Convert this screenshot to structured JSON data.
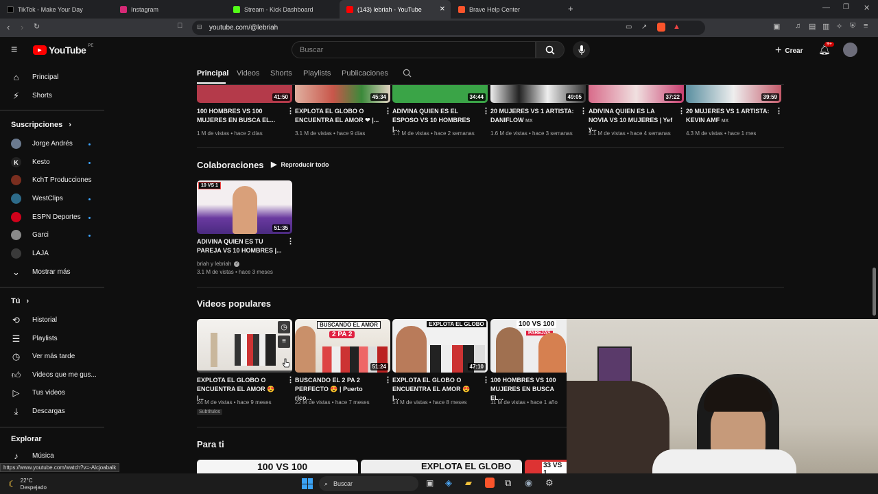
{
  "browser": {
    "tabs": [
      {
        "label": "TikTok - Make Your Day",
        "color": "#111"
      },
      {
        "label": "Instagram",
        "color": "#d62976"
      },
      {
        "label": "Stream - Kick Dashboard",
        "color": "#53fc18"
      },
      {
        "label": "(143) lebriah - YouTube",
        "color": "#ff0000"
      },
      {
        "label": "Brave Help Center",
        "color": "#fb542b"
      }
    ],
    "url": "youtube.com/@lebriah",
    "status_url": "https://www.youtube.com/watch?v=-Alcjoabalk"
  },
  "header": {
    "logo": "YouTube",
    "logo_region": "PE",
    "search_placeholder": "Buscar",
    "create_label": "Crear",
    "notif_badge": "9+"
  },
  "sidebar": {
    "main": [
      {
        "label": "Principal",
        "icon": "home-icon"
      },
      {
        "label": "Shorts",
        "icon": "shorts-icon"
      }
    ],
    "subs_title": "Suscripciones",
    "subs": [
      {
        "label": "Jorge Andrés",
        "color": "#6b7a8f",
        "dot": true
      },
      {
        "label": "Kesto",
        "color": "#222",
        "dot": true
      },
      {
        "label": "KchT Producciones",
        "color": "#7a2e1f",
        "dot": false
      },
      {
        "label": "WestClips",
        "color": "#2d6b8a",
        "dot": true
      },
      {
        "label": "ESPN Deportes",
        "color": "#d0021b",
        "dot": true
      },
      {
        "label": "Garci",
        "color": "#8a8a8a",
        "dot": true
      },
      {
        "label": "LAJA",
        "color": "#3a3a3a",
        "dot": false
      }
    ],
    "show_more": "Mostrar más",
    "you_title": "Tú",
    "you": [
      {
        "label": "Historial",
        "icon": "history-icon"
      },
      {
        "label": "Playlists",
        "icon": "playlists-icon"
      },
      {
        "label": "Ver más tarde",
        "icon": "watch-later-icon"
      },
      {
        "label": "Videos que me gus...",
        "icon": "like-icon"
      },
      {
        "label": "Tus videos",
        "icon": "your-videos-icon"
      },
      {
        "label": "Descargas",
        "icon": "downloads-icon"
      }
    ],
    "explore_title": "Explorar",
    "explore": [
      {
        "label": "Música",
        "icon": "music-icon"
      }
    ]
  },
  "channel_tabs": [
    "Principal",
    "Videos",
    "Shorts",
    "Playlists",
    "Publicaciones"
  ],
  "row1": [
    {
      "title": "100 HOMBRES VS 100 MUJERES EN BUSCA EL...",
      "meta": "1 M de vistas • hace 2 días",
      "dur": "41:50",
      "color": "#b43a4a"
    },
    {
      "title": "EXPLOTA EL GLOBO O ENCUENTRA EL AMOR ❤ |...",
      "meta": "3.1 M de vistas • hace 9 días",
      "dur": "45:34",
      "color": "#c8564a"
    },
    {
      "title": "ADIVINA QUIEN ES EL ESPOSO VS 10 HOMBRES |...",
      "meta": "1.7 M de vistas • hace 2 semanas",
      "dur": "34:44",
      "color": "#3aa447"
    },
    {
      "title": "20 MUJERES VS 1 ARTISTA: DANIFLOW",
      "tag": "MX",
      "meta": "1.6 M de vistas • hace 3 semanas",
      "dur": "49:05",
      "color": "#e8e0e0"
    },
    {
      "title": "ADIVINA QUIEN ES LA NOVIA VS 10 MUJERES | Yef y...",
      "meta": "3.1 M de vistas • hace 4 semanas",
      "dur": "37:22",
      "color": "#d86b8a"
    },
    {
      "title": "20 MUJERES VS 1 ARTISTA: KEVIN AMF",
      "tag": "MX",
      "meta": "4.3 M de vistas • hace 1 mes",
      "dur": "39:59",
      "color": "#5a8fa0"
    }
  ],
  "collab": {
    "title": "Colaboraciones",
    "play_all": "Reproducir todo",
    "video": {
      "title": "ADIVINA QUIEN ES TU PAREJA VS 10 HOMBRES |...",
      "channel": "briah y lebriah",
      "meta": "3.1 M de vistas • hace 3 meses",
      "dur": "51:35",
      "badge": "10 VS 1"
    }
  },
  "popular": {
    "title": "Videos populares",
    "videos": [
      {
        "title": "EXPLOTA EL GLOBO O ENCUENTRA EL AMOR 😍 |...",
        "meta": "24 M de vistas • hace 9 meses",
        "dur": "",
        "badge": "Subtítulos",
        "color": "#e9e6e2"
      },
      {
        "title": "BUSCANDO EL 2 PA 2 PERFECTO 😍 | Puerto rico...",
        "meta": "22 M de vistas • hace 7 meses",
        "dur": "51:24",
        "overlay": "BUSCANDO EL AMOR",
        "overlay2": "2 PA 2",
        "color": "#f2efe9"
      },
      {
        "title": "EXPLOTA EL GLOBO O ENCUENTRA EL AMOR 😍 |...",
        "meta": "14 M de vistas • hace 8 meses",
        "dur": "47:10",
        "overlay": "EXPLOTA EL GLOBO",
        "color": "#f1f1f1"
      },
      {
        "title": "100 HOMBRES VS 100 MUJERES EN BUSCA EL...",
        "meta": "11 M de vistas • hace 1 año",
        "dur": "",
        "overlay": "100 VS 100",
        "overlay2": "PAREJAS",
        "color": "#eee"
      }
    ]
  },
  "para_ti": {
    "title": "Para ti",
    "overlays": [
      "100 VS 100",
      "EXPLOTA EL GLOBO",
      "33 VS 1"
    ]
  },
  "taskbar": {
    "temp": "22°C",
    "weather": "Despejado",
    "search": "Buscar"
  }
}
